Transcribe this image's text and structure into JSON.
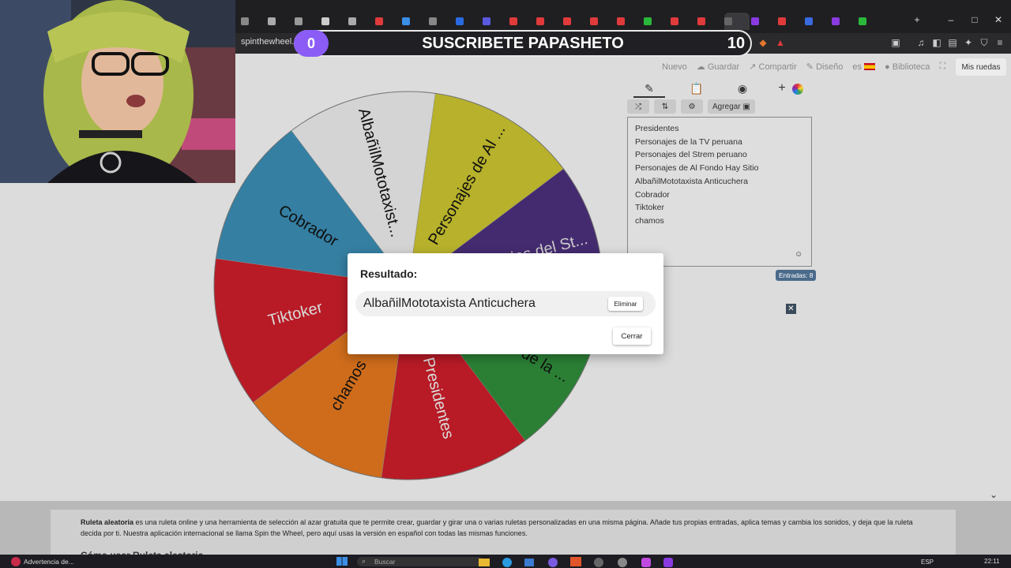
{
  "browser": {
    "url_text": "spinthewheel.io",
    "tabs_count_icons": 26
  },
  "stream_overlay": {
    "left_value": "0",
    "title": "SUSCRIBETE PAPASHETO",
    "right_value": "10"
  },
  "topnav": {
    "items": [
      "Nuevo",
      "Guardar",
      "Compartir",
      "Diseño",
      "es",
      "Biblioteca"
    ],
    "mis_ruedas": "Mis ruedas"
  },
  "editor": {
    "add_label": "Agregar",
    "entries": [
      "Presidentes",
      "Personajes de la TV peruana",
      "Personajes del Strem peruano",
      "Personajes de Al Fondo Hay Sitio",
      "AlbañilMototaxista Anticuchera",
      "Cobrador",
      "Tiktoker",
      "chamos"
    ],
    "entries_badge": "Entradas: 8"
  },
  "wheel": {
    "segments": [
      {
        "label": "Cobrador",
        "color": "#3a8ab0"
      },
      {
        "label": "AlbañilMototaxist...",
        "color": "#e6e6e6"
      },
      {
        "label": "Personajes de Al ...",
        "color": "#c7c12f"
      },
      {
        "label": "Personajes del St...",
        "color": "#4a2f7a"
      },
      {
        "label": "Personajes de la ...",
        "color": "#2f8a3a"
      },
      {
        "label": "Presidentes",
        "color": "#c81e2a"
      },
      {
        "label": "chamos",
        "color": "#e0761e"
      },
      {
        "label": "Tiktoker",
        "color": "#c81e2a"
      }
    ]
  },
  "modal": {
    "title": "Resultado:",
    "result": "AlbañilMototaxista Anticuchera",
    "delete_label": "Eliminar",
    "close_label": "Cerrar"
  },
  "description": {
    "bold_term": "Ruleta aleatoria",
    "text": " es una ruleta online y una herramienta de selección al azar gratuita que te permite crear, guardar y girar una o varias ruletas personalizadas en una misma página. Añade tus propias entradas, aplica temas y cambia los sonidos, y deja que la ruleta decida por ti. Nuestra aplicación internacional se llama Spin the Wheel, pero aquí usas la versión en español con todas las mismas funciones.",
    "howto_prefix": "Cómo usar",
    "howto_term": "Ruleta aleatoria"
  },
  "taskbar": {
    "warning": "Advertencia de...",
    "search": "Buscar",
    "lang": "ESP",
    "time": "22:11"
  },
  "colors": {
    "accent_purple": "#8b5cf6",
    "dark_chrome": "#1f1f22"
  }
}
